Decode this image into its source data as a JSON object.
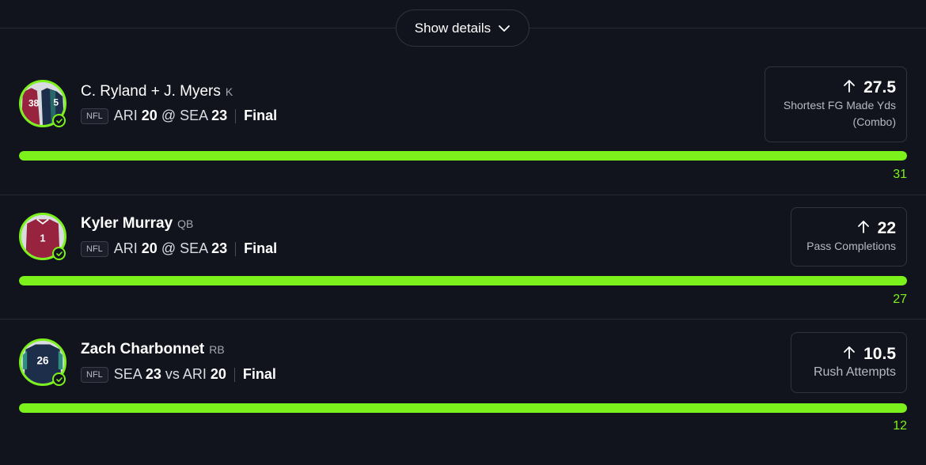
{
  "header": {
    "show_details_label": "Show details"
  },
  "picks": [
    {
      "player": "C. Ryland + J. Myers",
      "position": "K",
      "league": "NFL",
      "matchup_prefix": "ARI ",
      "team1_score": "20",
      "connector": " @ SEA ",
      "team2_score": "23",
      "status": "Final",
      "direction": "higher",
      "line": "27.5",
      "stat_line1": "Shortest FG Made Yds",
      "stat_line2": "(Combo)",
      "result": "31",
      "progress": 1.0,
      "jersey_numbers": [
        "38",
        "5"
      ]
    },
    {
      "player": "Kyler Murray",
      "position": "QB",
      "league": "NFL",
      "matchup_prefix": "ARI ",
      "team1_score": "20",
      "connector": " @ SEA ",
      "team2_score": "23",
      "status": "Final",
      "direction": "higher",
      "line": "22",
      "stat_line1": "Pass Completions",
      "result": "27",
      "progress": 1.0,
      "jersey_numbers": [
        "1"
      ]
    },
    {
      "player": "Zach Charbonnet",
      "position": "RB",
      "league": "NFL",
      "matchup_prefix": "SEA ",
      "team1_score": "23",
      "connector": " vs ARI ",
      "team2_score": "20",
      "status": "Final",
      "direction": "higher",
      "line": "10.5",
      "stat_line1": "Rush Attempts",
      "result": "12",
      "progress": 1.0,
      "jersey_numbers": [
        "26"
      ]
    }
  ],
  "colors": {
    "background": "#12141d",
    "accent_green": "#7cf11c",
    "cardinals_red": "#97233f",
    "seahawks_navy": "#1d2e4a"
  },
  "icons": [
    "chevron-down-icon",
    "arrow-up-icon",
    "check-icon"
  ]
}
